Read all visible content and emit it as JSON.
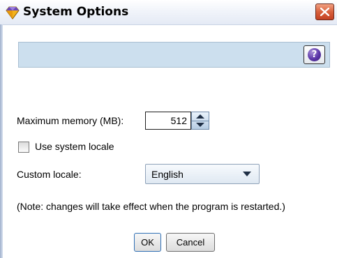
{
  "window": {
    "title": "System Options",
    "icon": "diamond-app-icon",
    "close_icon": "close-icon"
  },
  "toolbar": {
    "help_icon": "help-icon",
    "help_glyph": "?"
  },
  "form": {
    "max_memory_label": "Maximum memory (MB):",
    "max_memory_value": "512",
    "use_system_locale_label": "Use system locale",
    "use_system_locale_checked": false,
    "custom_locale_label": "Custom locale:",
    "custom_locale_value": "English",
    "note": "(Note: changes will take effect when the program is restarted.)"
  },
  "buttons": {
    "ok": "OK",
    "cancel": "Cancel"
  },
  "colors": {
    "toolbar_bg": "#ccdfee",
    "close_button": "#d8603c",
    "help_button": "#5b36a8"
  }
}
